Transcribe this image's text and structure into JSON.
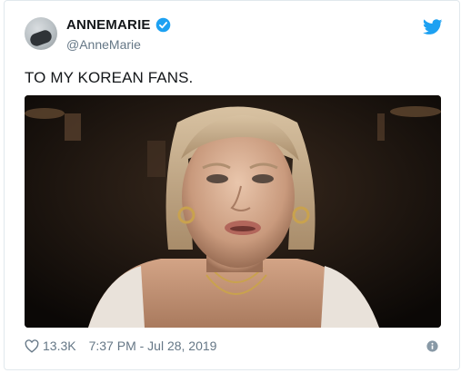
{
  "tweet": {
    "display_name": "ANNEMARIE",
    "handle": "@AnneMarie",
    "text": "TO MY KOREAN FANS.",
    "like_count": "13.3K",
    "timestamp": "7:37 PM - Jul 28, 2019"
  },
  "icons": {
    "verified": "verified-badge-icon",
    "brand": "twitter-bird-icon",
    "like": "heart-icon",
    "info": "info-icon"
  },
  "colors": {
    "accent": "#1da1f2",
    "text": "#14171a",
    "secondary": "#657786",
    "border": "#e1e8ed"
  }
}
